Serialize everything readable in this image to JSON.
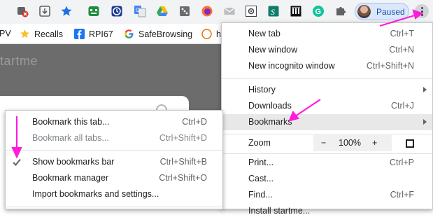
{
  "toolbar": {
    "profile_status": "Paused",
    "menu_button": "Chrome menu"
  },
  "bookmarks_bar": {
    "items": [
      {
        "label": "PV",
        "icon": "truncated-icon"
      },
      {
        "label": "Recalls",
        "icon": "star-icon"
      },
      {
        "label": "RPI67",
        "icon": "facebook-icon"
      },
      {
        "label": "SafeBrowsing",
        "icon": "google-icon"
      },
      {
        "label": "h",
        "icon": "truncated-icon"
      }
    ]
  },
  "page": {
    "logo_text": "tartme"
  },
  "chrome_menu": {
    "items": [
      {
        "label": "New tab",
        "shortcut": "Ctrl+T"
      },
      {
        "label": "New window",
        "shortcut": "Ctrl+N"
      },
      {
        "label": "New incognito window",
        "shortcut": "Ctrl+Shift+N"
      },
      {
        "label": "History",
        "shortcut": ""
      },
      {
        "label": "Downloads",
        "shortcut": "Ctrl+J"
      },
      {
        "label": "Bookmarks",
        "shortcut": ""
      },
      {
        "label": "Cast...",
        "shortcut": ""
      },
      {
        "label": "Find...",
        "shortcut": "Ctrl+F"
      },
      {
        "label": "Install startme...",
        "shortcut": ""
      }
    ],
    "zoom": {
      "label": "Zoom",
      "minus": "−",
      "value": "100%",
      "plus": "+"
    },
    "print": {
      "label": "Print...",
      "shortcut": "Ctrl+P"
    }
  },
  "bookmarks_menu": {
    "items": [
      {
        "label": "Bookmark this tab...",
        "shortcut": "Ctrl+D",
        "disabled": false
      },
      {
        "label": "Bookmark all tabs...",
        "shortcut": "Ctrl+Shift+D",
        "disabled": true
      },
      {
        "label": "Show bookmarks bar",
        "shortcut": "Ctrl+Shift+B",
        "checked": true
      },
      {
        "label": "Bookmark manager",
        "shortcut": "Ctrl+Shift+O"
      },
      {
        "label": "Import bookmarks and settings...",
        "shortcut": ""
      }
    ]
  },
  "colors": {
    "annotation_arrow": "#ff1bdc",
    "menu_highlight": "#e8e8e9",
    "toolbar_bg": "#f1f3f4"
  }
}
